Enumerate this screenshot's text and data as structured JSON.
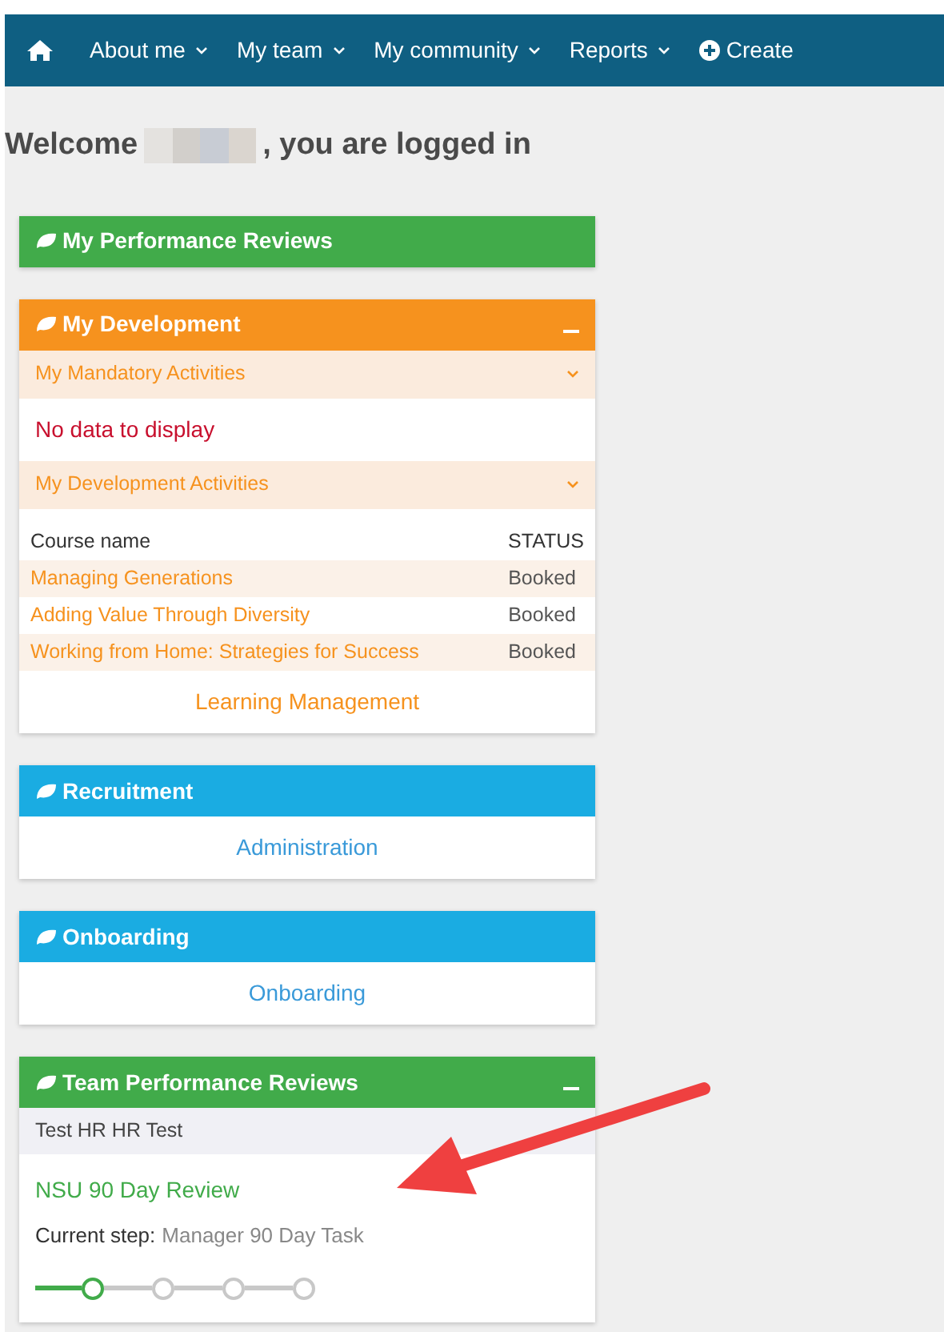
{
  "nav": {
    "items": [
      {
        "kind": "home"
      },
      {
        "kind": "menu",
        "label": "About me"
      },
      {
        "kind": "menu",
        "label": "My team"
      },
      {
        "kind": "menu",
        "label": "My community"
      },
      {
        "kind": "menu",
        "label": "Reports"
      },
      {
        "kind": "create",
        "label": "Create"
      }
    ]
  },
  "welcome": {
    "before": "Welcome",
    "after": ", you are logged in"
  },
  "panels": [
    {
      "title": "My Performance Reviews",
      "color": "#41ab4a",
      "collapsible": false
    },
    {
      "title": "My Development",
      "color": "#f6921e",
      "collapsible": true,
      "sections": [
        {
          "kind": "accordion",
          "label": "My Mandatory Activities"
        },
        {
          "kind": "empty",
          "text": "No data to display"
        },
        {
          "kind": "accordion",
          "label": "My Development Activities"
        },
        {
          "kind": "table",
          "columns": [
            "Course name",
            "STATUS"
          ],
          "rows": [
            [
              "Managing Generations",
              "Booked"
            ],
            [
              "Adding Value Through Diversity",
              "Booked"
            ],
            [
              "Working from Home: Strategies for Success",
              "Booked"
            ]
          ]
        },
        {
          "kind": "link",
          "label": "Learning Management"
        }
      ]
    },
    {
      "title": "Recruitment",
      "color": "#1aace2",
      "collapsible": false,
      "sections": [
        {
          "kind": "link",
          "label": "Administration"
        }
      ]
    },
    {
      "title": "Onboarding",
      "color": "#1aace2",
      "collapsible": false,
      "sections": [
        {
          "kind": "link",
          "label": "Onboarding"
        }
      ]
    },
    {
      "title": "Team Performance Reviews",
      "color": "#41ab4a",
      "collapsible": true,
      "sections": [
        {
          "kind": "select",
          "label": "Test HR HR Test"
        },
        {
          "kind": "review",
          "title": "NSU 90 Day Review",
          "step_label": "Current step:",
          "step": "Manager 90 Day Task",
          "steps": [
            {
              "selected": true
            },
            {
              "selected": false
            },
            {
              "selected": false
            },
            {
              "selected": false
            }
          ]
        }
      ]
    }
  ]
}
